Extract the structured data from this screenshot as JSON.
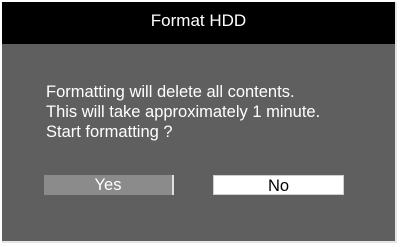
{
  "dialog": {
    "title": "Format HDD",
    "message_lines": [
      "Formatting will delete all contents.",
      "This will take approximately 1 minute.",
      "Start formatting ?"
    ],
    "buttons": {
      "yes_label": "Yes",
      "no_label": "No"
    }
  },
  "colors": {
    "titlebar_bg": "#000000",
    "dialog_bg": "#5f5f5f",
    "yes_bg": "#8b8b8b",
    "no_bg": "#ffffff",
    "text_light": "#ffffff",
    "text_dark": "#000000"
  }
}
